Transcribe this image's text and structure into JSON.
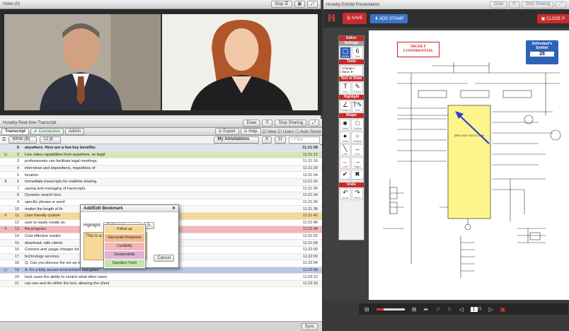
{
  "video": {
    "title": "Video (0)",
    "stop_label": "Stop ☰"
  },
  "transcript": {
    "title": "Huseby Real-time Transcript",
    "draw_label": "Draw",
    "stop_sharing": "Stop Sharing",
    "tabs": [
      "Transcript",
      "✔ Connection",
      "Admin"
    ],
    "export_label": "⊙ Export",
    "help_label": "⊙ Help",
    "view_label": "☑ View",
    "users_label": "☑ Users",
    "autoscroll_label": "☐ Auto Scroll",
    "theme_value": "White (B)",
    "font_value": "12 pt",
    "annotations_label": "My Annotations",
    "page_value": "8",
    "line_value": "11",
    "find_placeholder": "Find",
    "sync_label": "Sync",
    "rows": [
      {
        "n": "8",
        "text": "anywhere. Here are a few key benefits:",
        "time": "11:21:08",
        "style": "head",
        "icon": ""
      },
      {
        "n": "2",
        "text": "Live video capabilities from anywhere, so legal",
        "time": "11:21:12",
        "style": "green",
        "icon": "▤"
      },
      {
        "n": "3",
        "text": "professionals can facilitate legal meetings,",
        "time": "11:21:16",
        "style": "",
        "icon": ""
      },
      {
        "n": "4",
        "text": "interviews and depositions, regardless of",
        "time": "11:21:20",
        "style": "alt",
        "icon": ""
      },
      {
        "n": "5",
        "text": "location.",
        "time": "11:21:24",
        "style": "",
        "icon": ""
      },
      {
        "n": "6",
        "text": "Immediate transcripts for realtime sharing.",
        "time": "11:21:26",
        "style": "alt",
        "icon": "♜"
      },
      {
        "n": "7",
        "text": "saving and managing of transcripts.",
        "time": "11:21:30",
        "style": "",
        "icon": ""
      },
      {
        "n": "8",
        "text": "Dynamic search func",
        "time": "11:21:34",
        "style": "alt",
        "icon": ""
      },
      {
        "n": "9",
        "text": "specific phrase or word",
        "time": "11:21:36",
        "style": "",
        "icon": ""
      },
      {
        "n": "10",
        "text": "matter the length of th",
        "time": "11:21:38",
        "style": "alt",
        "icon": ""
      },
      {
        "n": "11",
        "text": "User friendly custom",
        "time": "11:21:42",
        "style": "amber",
        "icon": "♜"
      },
      {
        "n": "12",
        "text": "user to easily create an",
        "time": "11:21:46",
        "style": "",
        "icon": ""
      },
      {
        "n": "13",
        "text": "the program.",
        "time": "11:21:48",
        "style": "pink",
        "icon": "♜"
      },
      {
        "n": "14",
        "text": "Cost effective solutio",
        "time": "11:21:52",
        "style": "",
        "icon": ""
      },
      {
        "n": "15",
        "text": "download, with clients",
        "time": "11:21:58",
        "style": "alt",
        "icon": ""
      },
      {
        "n": "16",
        "text": "Connect and usage charges for the transcription",
        "time": "11:22:00",
        "style": "",
        "icon": ""
      },
      {
        "n": "17",
        "text": "technology services.",
        "time": "11:22:00",
        "style": "alt",
        "icon": ""
      },
      {
        "n": "18",
        "text": "Q.  Can you discuss the set up environment?",
        "time": "11:22:04",
        "style": "",
        "icon": ""
      },
      {
        "n": "19",
        "text": "A.  It's a fully secure environment that gives",
        "time": "11:22:08",
        "style": "blue",
        "icon": "▤"
      },
      {
        "n": "20",
        "text": "host users the ability to control what other users",
        "time": "11:22:12",
        "style": "",
        "icon": ""
      },
      {
        "n": "21",
        "text": "can see and do within the tool, allowing the client",
        "time": "11:22:18",
        "style": "alt",
        "icon": ""
      }
    ]
  },
  "bookmark_dialog": {
    "title": "Add/Edit Bookmark",
    "highlight_label": "Highlight:",
    "selected": "Follow up",
    "note_text": "This is a su",
    "cancel_label": "Cancel",
    "options": [
      {
        "label": "Follow up",
        "color": "#f6d998"
      },
      {
        "label": "Inaccurate Response",
        "color": "#f1b98d"
      },
      {
        "label": "Credibility",
        "color": "#f3b6ba"
      },
      {
        "label": "Sustainability",
        "color": "#e0b3d6"
      },
      {
        "label": "Question: Form",
        "color": "#c9e3b0"
      }
    ]
  },
  "exhibit": {
    "title": "Huseby Exhibit Presentation",
    "save_label": "SAVE",
    "add_stamp_label": "ADD STAMP",
    "close_label": "CLOSE P",
    "confidential": "HIGHLY CONFIDENTIAL",
    "stamp_line1": "Defendant's",
    "stamp_line2": "Exhibit",
    "stamp_number": "28",
    "tools": {
      "editor": "Editor",
      "settings": "Settings",
      "size_value": "6",
      "zoom_value": "100%",
      "sections": [
        "Tools",
        "Text or Draw",
        "Highlight",
        "Shape",
        "Undo"
      ],
      "change_move": "Change / Move"
    },
    "chip_label": "IMPCODE HIGHCLAIM",
    "page_value": "1",
    "page_total": "/1"
  }
}
